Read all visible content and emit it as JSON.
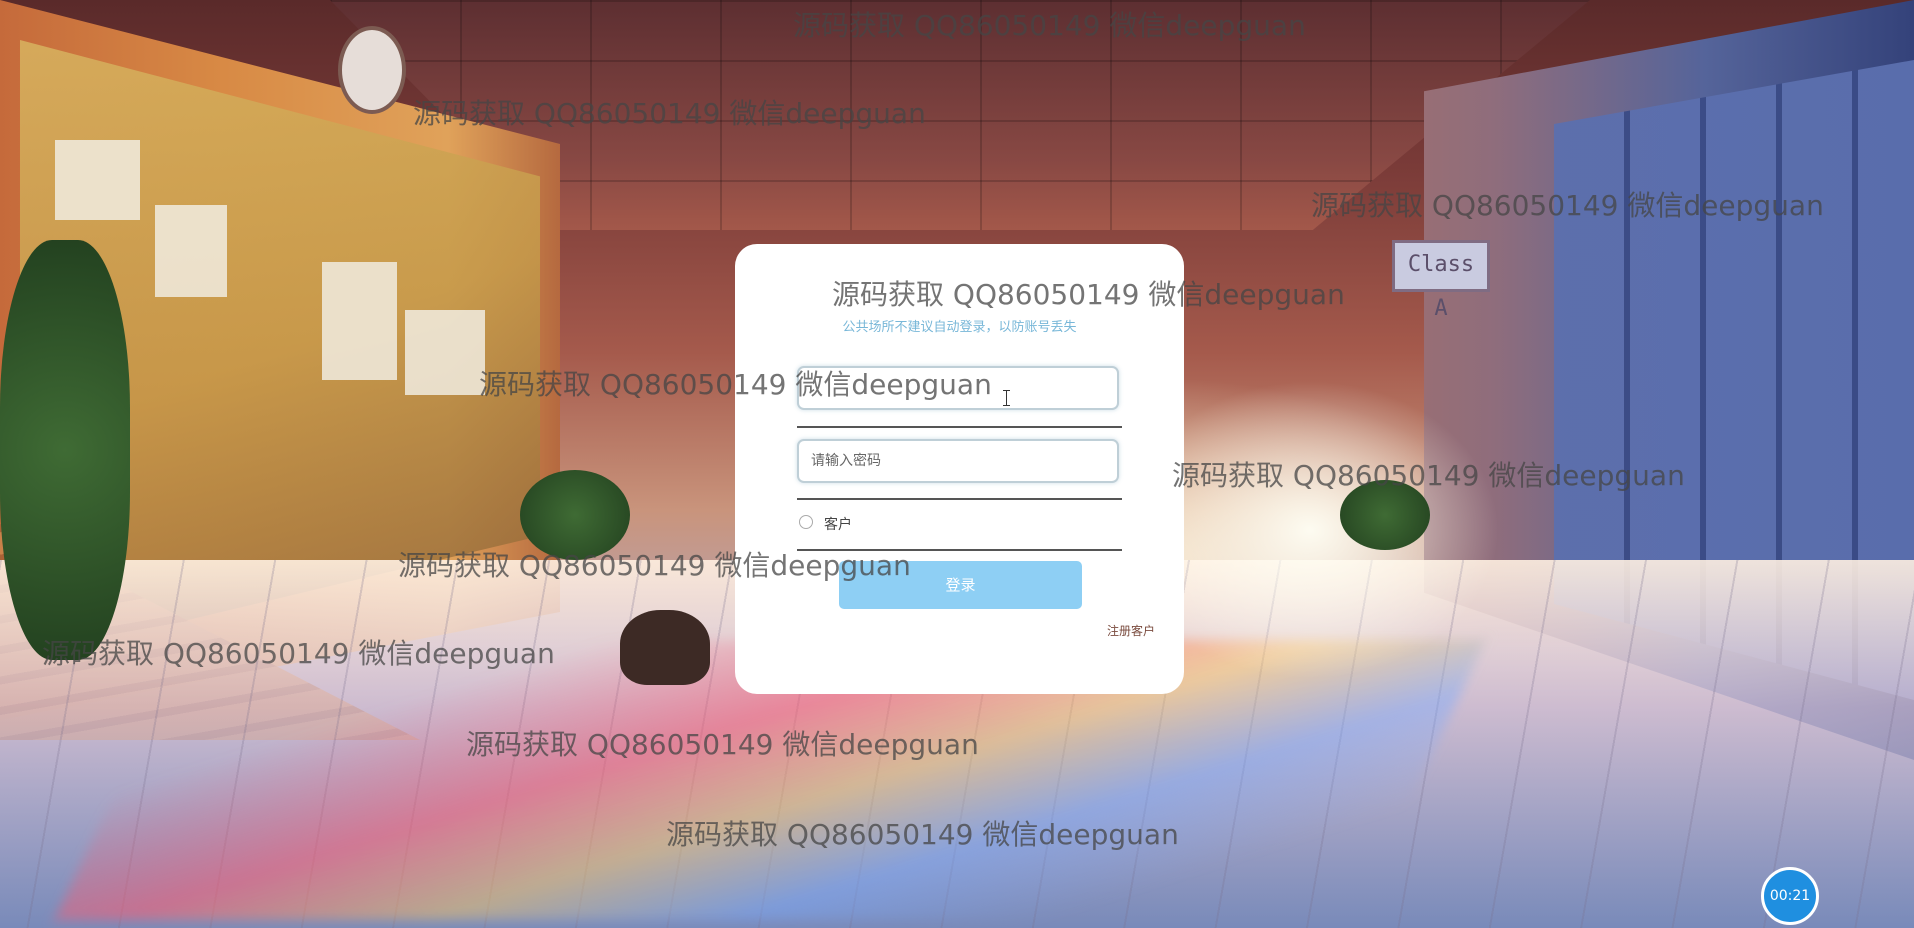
{
  "login": {
    "tip": "公共场所不建议自动登录，以防账号丢失",
    "username_value": "",
    "username_placeholder": "",
    "password_placeholder": "请输入密码",
    "role_option": "客户",
    "login_button": "登录",
    "register_link": "注册客户"
  },
  "watermark": {
    "text": "源码获取 QQ86050149 微信deepguan"
  },
  "background": {
    "sign_text": "Class A"
  },
  "timer": {
    "text": "00:21"
  },
  "colors": {
    "button": "#8ecff4",
    "tip": "#78b7d8",
    "timer": "#1f8fe0"
  }
}
